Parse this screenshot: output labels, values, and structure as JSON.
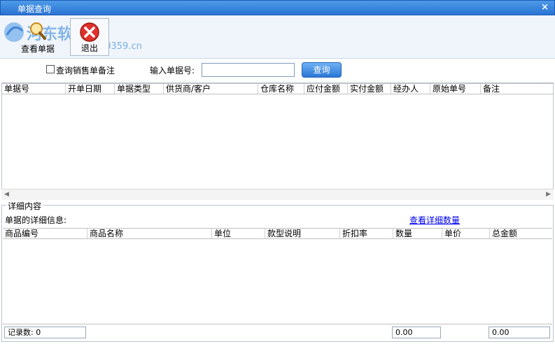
{
  "window": {
    "title": "单据查询",
    "close_label": "×"
  },
  "watermark": {
    "text_cn": "河东软件园",
    "url": "www.pc0359.cn"
  },
  "toolbar": {
    "view_label": "查看单据",
    "exit_label": "退出"
  },
  "search": {
    "checkbox_label": "查询销售单备注",
    "input_label": "输入单据号:",
    "input_value": "",
    "query_label": "查询"
  },
  "top_grid": {
    "columns": [
      "单据号",
      "开单日期",
      "单据类型",
      "供货商/客户",
      "仓库名称",
      "应付金额",
      "实付金额",
      "经办人",
      "原始单号",
      "备注"
    ]
  },
  "detail": {
    "group_title": "详细内容",
    "info_label": "单据的详细信息:",
    "link_label": "查看详细数量",
    "columns": [
      "商品编号",
      "商品名称",
      "单位",
      "款型说明",
      "折扣率",
      "数量",
      "单价",
      "总金额"
    ]
  },
  "status": {
    "record_count": "记录数: 0",
    "quantity_total": "0.00",
    "amount_total": "0.00"
  },
  "colors": {
    "titlebar": "#2a74d4",
    "query_button": "#2a77d6",
    "link": "#0000ee"
  }
}
